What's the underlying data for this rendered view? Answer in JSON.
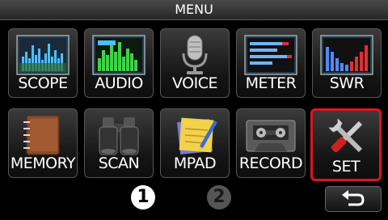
{
  "header": {
    "title": "MENU"
  },
  "tiles": [
    {
      "label": "SCOPE",
      "icon": "scope-icon"
    },
    {
      "label": "AUDIO",
      "icon": "audio-icon"
    },
    {
      "label": "VOICE",
      "icon": "microphone-icon"
    },
    {
      "label": "METER",
      "icon": "meter-icon"
    },
    {
      "label": "SWR",
      "icon": "swr-icon"
    },
    {
      "label": "MEMORY",
      "icon": "notebook-icon"
    },
    {
      "label": "SCAN",
      "icon": "binoculars-icon"
    },
    {
      "label": "MPAD",
      "icon": "memo-pad-icon"
    },
    {
      "label": "RECORD",
      "icon": "cassette-icon"
    },
    {
      "label": "SET",
      "icon": "wrench-screwdriver-icon",
      "selected": true
    }
  ],
  "pager": {
    "page1": "1",
    "page2": "2",
    "current": 1
  },
  "back_button": {
    "icon": "return-arrow-icon"
  },
  "colors": {
    "selection_border": "#e0141e",
    "background": "#000000"
  }
}
